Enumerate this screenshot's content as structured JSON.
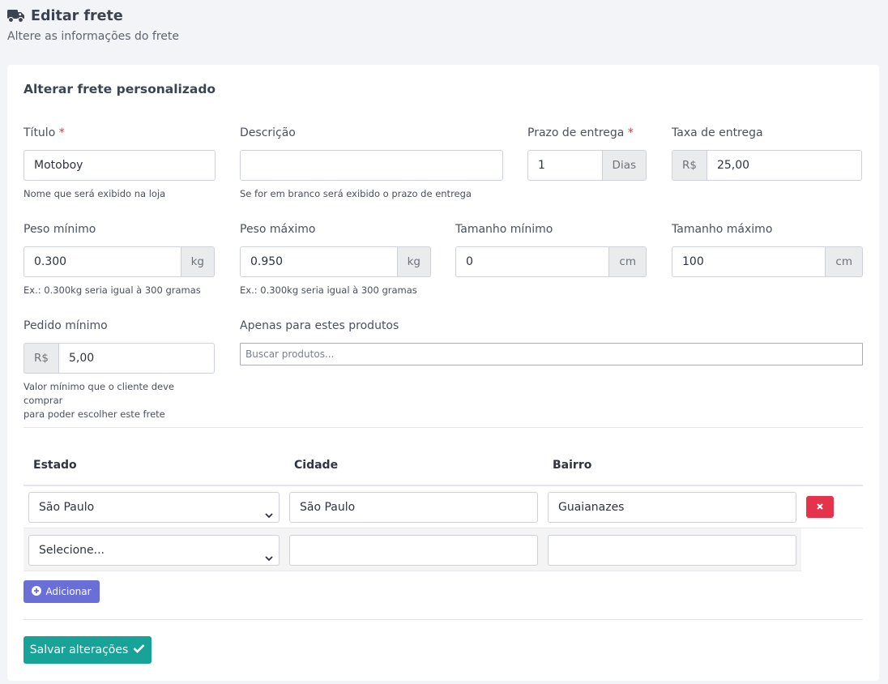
{
  "header": {
    "title": "Editar frete",
    "subtitle": "Altere as informações do frete",
    "icon": "truck-icon"
  },
  "card": {
    "title": "Alterar frete personalizado"
  },
  "form": {
    "titulo": {
      "label": "Título",
      "required": "*",
      "value": "Motoboy",
      "help": "Nome que será exibido na loja"
    },
    "descricao": {
      "label": "Descrição",
      "value": "",
      "help": "Se for em branco será exibido o prazo de entrega"
    },
    "prazo": {
      "label": "Prazo de entrega",
      "required": "*",
      "value": "1",
      "addon": "Dias"
    },
    "taxa": {
      "label": "Taxa de entrega",
      "addon": "R$",
      "value": "25,00"
    },
    "peso_min": {
      "label": "Peso mínimo",
      "value": "0.300",
      "addon": "kg",
      "help": "Ex.: 0.300kg seria igual à 300 gramas"
    },
    "peso_max": {
      "label": "Peso máximo",
      "value": "0.950",
      "addon": "kg",
      "help": "Ex.: 0.300kg seria igual à 300 gramas"
    },
    "tam_min": {
      "label": "Tamanho mínimo",
      "value": "0",
      "addon": "cm"
    },
    "tam_max": {
      "label": "Tamanho máximo",
      "value": "100",
      "addon": "cm"
    },
    "pedido_min": {
      "label": "Pedido mínimo",
      "addon": "R$",
      "value": "5,00",
      "help_line1": "Valor mínimo que o cliente deve comprar",
      "help_line2": "para poder escolher este frete"
    },
    "produtos": {
      "label": "Apenas para estes produtos",
      "placeholder": "Buscar produtos..."
    }
  },
  "table": {
    "headers": {
      "estado": "Estado",
      "cidade": "Cidade",
      "bairro": "Bairro"
    },
    "rows": [
      {
        "estado": "São Paulo",
        "cidade": "São Paulo",
        "bairro": "Guaianazes"
      },
      {
        "estado": "Selecione...",
        "cidade": "",
        "bairro": ""
      }
    ]
  },
  "buttons": {
    "add": "Adicionar",
    "save": "Salvar alterações"
  },
  "colors": {
    "danger": "#e5334c",
    "primary": "#6a6fd8",
    "success": "#17a398"
  }
}
